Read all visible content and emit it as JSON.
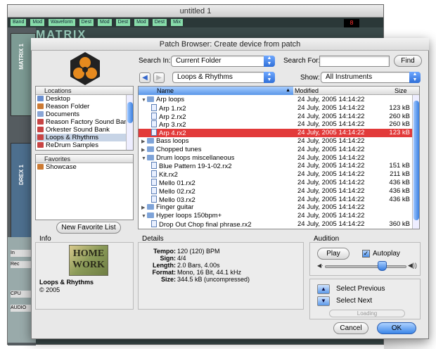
{
  "background_window": {
    "title": "untitled 1",
    "toolbar_labels": [
      "Band",
      "Mod",
      "Waveform",
      "Dest",
      "Mod",
      "Dest",
      "Mod",
      "Dest",
      "Mix"
    ],
    "matrix_label": "MATRIX",
    "matrix_rack": "MATRIX 1",
    "drex_rack": "DREX 1",
    "led": "8",
    "transport": [
      "In",
      "Rec",
      "CPU",
      "AUDIO"
    ]
  },
  "dialog": {
    "title": "Patch Browser: Create device from patch",
    "search_in_label": "Search In:",
    "search_in_value": "Current Folder",
    "search_for_label": "Search For:",
    "search_for_value": "",
    "find_button": "Find",
    "back_icon": "◀",
    "forward_icon": "▶",
    "location_popup": "Loops & Rhythms",
    "show_label": "Show:",
    "show_value": "All Instruments"
  },
  "locations": {
    "header": "Locations",
    "items": [
      {
        "label": "Desktop",
        "color": "#6a8fd0"
      },
      {
        "label": "Reason Folder",
        "color": "#cc7a33"
      },
      {
        "label": "Documents",
        "color": "#8aa6d6"
      },
      {
        "label": "Reason Factory Sound Bank",
        "color": "#c84444"
      },
      {
        "label": "Orkester Sound Bank",
        "color": "#c84444"
      },
      {
        "label": "Loops & Rhythms",
        "color": "#c84444",
        "selected": true
      },
      {
        "label": "ReDrum Samples",
        "color": "#c84444"
      }
    ]
  },
  "favorites": {
    "header": "Favorites",
    "items": [
      {
        "label": "Showcase",
        "color": "#cc7a33"
      }
    ],
    "new_button": "New Favorite List"
  },
  "file_list": {
    "columns": [
      "Name",
      "Modified",
      "Size"
    ],
    "rows": [
      {
        "name": "Arp loops",
        "type": "folder",
        "open": true,
        "level": 0,
        "modified": "24 July, 2005 14:14:22",
        "size": ""
      },
      {
        "name": "Arp 1.rx2",
        "type": "file",
        "level": 1,
        "modified": "24 July, 2005 14:14:22",
        "size": "123 kB"
      },
      {
        "name": "Arp 2.rx2",
        "type": "file",
        "level": 1,
        "modified": "24 July, 2005 14:14:22",
        "size": "260 kB"
      },
      {
        "name": "Arp 3.rx2",
        "type": "file",
        "level": 1,
        "modified": "24 July, 2005 14:14:22",
        "size": "260 kB"
      },
      {
        "name": "Arp 4.rx2",
        "type": "file",
        "level": 1,
        "modified": "24 July, 2005 14:14:22",
        "size": "123 kB",
        "selected": true
      },
      {
        "name": "Bass loops",
        "type": "folder",
        "open": false,
        "level": 0,
        "modified": "24 July, 2005 14:14:22",
        "size": ""
      },
      {
        "name": "Chopped tunes",
        "type": "folder",
        "open": false,
        "level": 0,
        "modified": "24 July, 2005 14:14:22",
        "size": ""
      },
      {
        "name": "Drum loops miscellaneous",
        "type": "folder",
        "open": true,
        "level": 0,
        "modified": "24 July, 2005 14:14:22",
        "size": ""
      },
      {
        "name": "Blue Pattern 19-1-02.rx2",
        "type": "file",
        "level": 1,
        "modified": "24 July, 2005 14:14:22",
        "size": "151 kB"
      },
      {
        "name": "Kit.rx2",
        "type": "file",
        "level": 1,
        "modified": "24 July, 2005 14:14:22",
        "size": "211 kB"
      },
      {
        "name": "Mello 01.rx2",
        "type": "file",
        "level": 1,
        "modified": "24 July, 2005 14:14:22",
        "size": "436 kB"
      },
      {
        "name": "Mello 02.rx2",
        "type": "file",
        "level": 1,
        "modified": "24 July, 2005 14:14:22",
        "size": "436 kB"
      },
      {
        "name": "Mello 03.rx2",
        "type": "file",
        "level": 1,
        "modified": "24 July, 2005 14:14:22",
        "size": "436 kB"
      },
      {
        "name": "Finger guitar",
        "type": "folder",
        "open": false,
        "level": 0,
        "modified": "24 July, 2005 14:14:22",
        "size": ""
      },
      {
        "name": "Hyper loops 150bpm+",
        "type": "folder",
        "open": true,
        "level": 0,
        "modified": "24 July, 2005 14:14:22",
        "size": ""
      },
      {
        "name": "Drop Out Chop final phrase.rx2",
        "type": "file",
        "level": 1,
        "modified": "24 July, 2005 14:14:22",
        "size": "360 kB"
      }
    ]
  },
  "info": {
    "title": "Info",
    "tile_line1": "HOME",
    "tile_line2": "WORK",
    "name": "Loops & Rhythms",
    "year": "© 2005"
  },
  "details": {
    "title": "Details",
    "lines": [
      {
        "label": "Tempo:",
        "value": "120 (120) BPM"
      },
      {
        "label": "Sign:",
        "value": "4/4"
      },
      {
        "label": "Length:",
        "value": "2.0 Bars, 4.00s"
      },
      {
        "label": "Format:",
        "value": "Mono, 16 Bit, 44.1 kHz"
      },
      {
        "label": "Size:",
        "value": "344.5 kB (uncompressed)"
      }
    ]
  },
  "audition": {
    "title": "Audition",
    "play_button": "Play",
    "autoplay_label": "Autoplay",
    "autoplay_checked": true,
    "volume_fraction": 0.7,
    "select_previous": "Select Previous",
    "select_next": "Select Next",
    "loading": "Loading"
  },
  "buttons": {
    "cancel": "Cancel",
    "ok": "OK"
  }
}
